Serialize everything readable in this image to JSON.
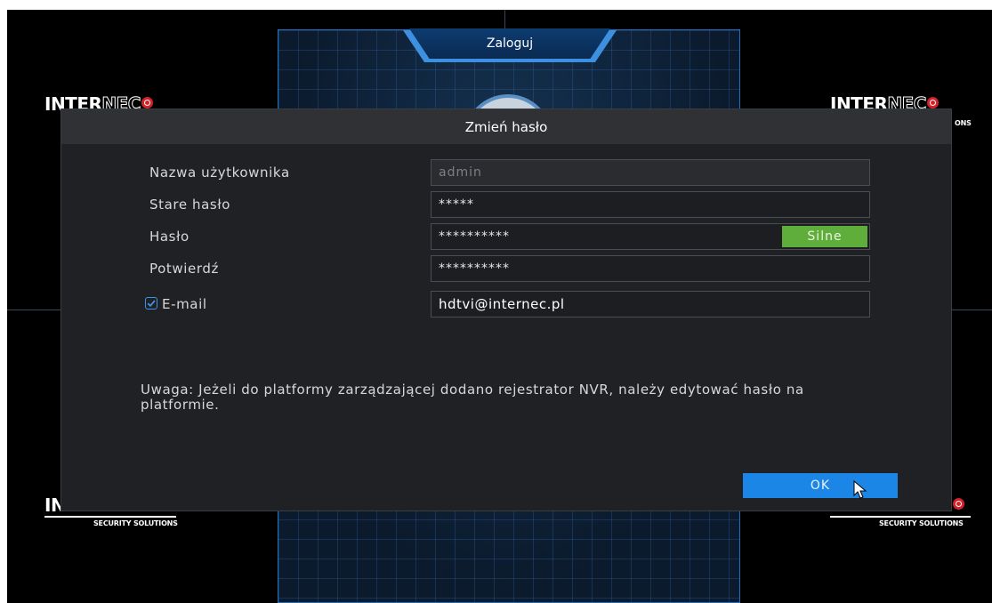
{
  "login": {
    "tab_title": "Zaloguj"
  },
  "brand": {
    "name_solid": "INTER",
    "name_outline": "NEC",
    "tagline": "SECURITY SOLUTIONS",
    "tagline_partial": "ONS"
  },
  "dialog": {
    "title": "Zmień hasło",
    "fields": {
      "username": {
        "label": "Nazwa użytkownika",
        "value": "admin"
      },
      "old_password": {
        "label": "Stare hasło",
        "value": "*****"
      },
      "password": {
        "label": "Hasło",
        "value": "**********",
        "strength": "Silne"
      },
      "confirm": {
        "label": "Potwierdź",
        "value": "**********"
      },
      "email": {
        "label": "E-mail",
        "value": "hdtvi@internec.pl",
        "checked": true
      }
    },
    "note": "Uwaga: Jeżeli do platformy zarządzającej dodano rejestrator NVR, należy edytować hasło na platformie.",
    "ok_label": "OK"
  },
  "colors": {
    "accent": "#1b86e6",
    "strength_strong": "#5fae3b",
    "dialog_bg": "#1f2124",
    "header_bg": "#2f3135"
  },
  "icons": {
    "checkbox": "checkbox-checked-icon",
    "cursor": "mouse-pointer-icon"
  }
}
